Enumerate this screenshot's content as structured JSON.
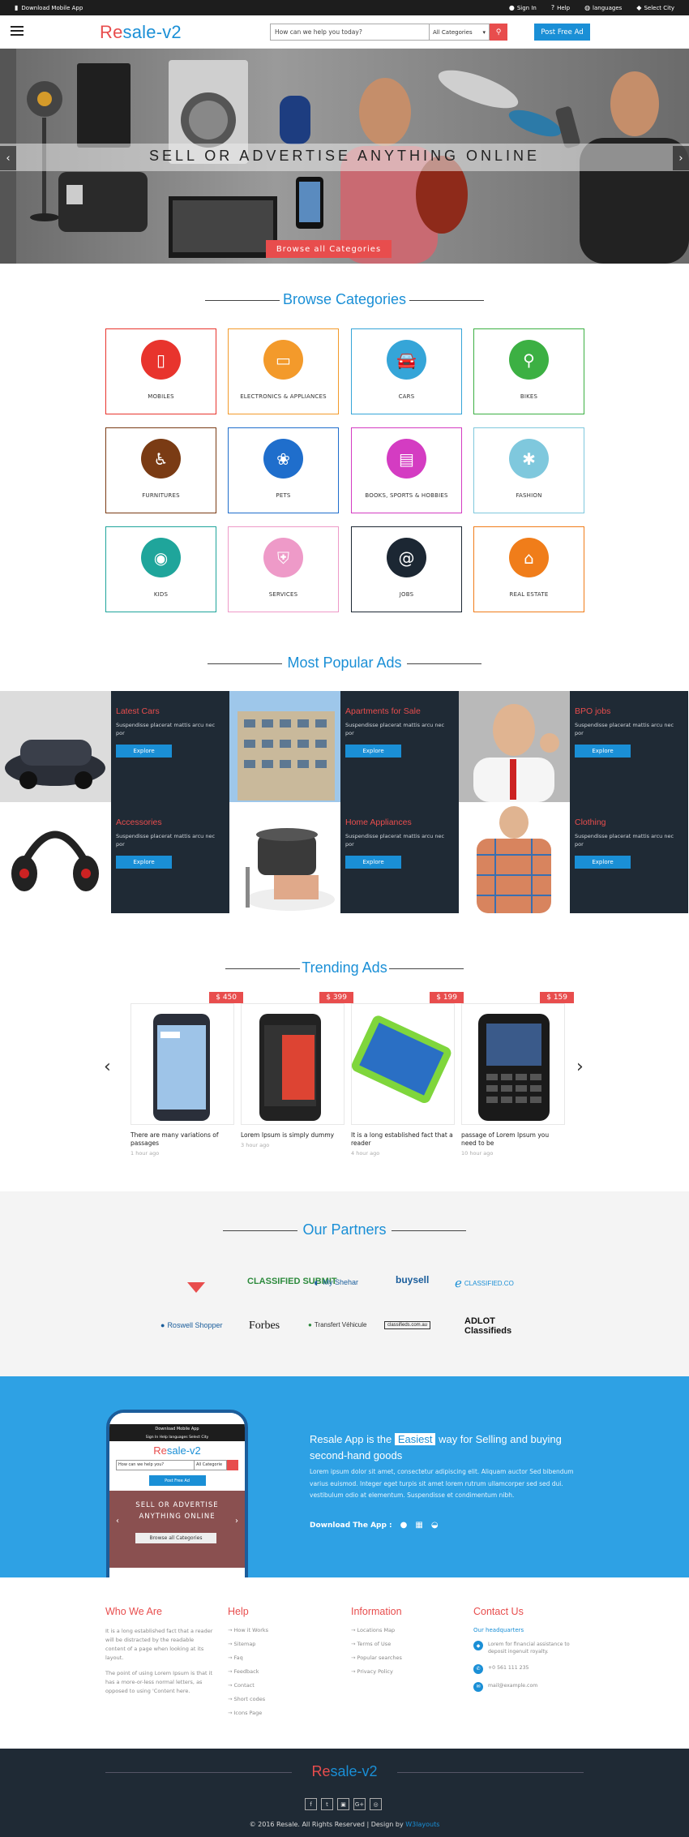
{
  "topbar": {
    "download": "Download Mobile App",
    "signin": "Sign In",
    "help": "Help",
    "languages": "languages",
    "city": "Select City"
  },
  "header": {
    "logo_a": "Re",
    "logo_b": "sale-v2",
    "search_placeholder": "How can we help you today?",
    "category_select": "All Categories",
    "post_ad": "Post Free Ad"
  },
  "hero": {
    "title": "SELL OR ADVERTISE ANYTHING ONLINE",
    "button": "Browse all Categories"
  },
  "categories": {
    "title": "Browse Categories",
    "items": [
      {
        "label": "MOBILES",
        "color": "#e8342d",
        "icon": "mobile-icon",
        "glyph": "▯"
      },
      {
        "label": "ELECTRONICS & APPLIANCES",
        "color": "#f39a2b",
        "icon": "laptop-icon",
        "glyph": "▭"
      },
      {
        "label": "CARS",
        "color": "#35a5d8",
        "icon": "car-icon",
        "glyph": "🚘"
      },
      {
        "label": "BIKES",
        "color": "#3cb043",
        "icon": "bike-icon",
        "glyph": "⚲"
      },
      {
        "label": "FURNITURES",
        "color": "#7a3b14",
        "icon": "wheelchair-icon",
        "glyph": "♿"
      },
      {
        "label": "PETS",
        "color": "#1f6ecc",
        "icon": "paw-icon",
        "glyph": "❀"
      },
      {
        "label": "BOOKS, SPORTS & HOBBIES",
        "color": "#d43cc2",
        "icon": "book-icon",
        "glyph": "▤"
      },
      {
        "label": "FASHION",
        "color": "#7fc8dd",
        "icon": "asterisk-icon",
        "glyph": "✱"
      },
      {
        "label": "KIDS",
        "color": "#1fa59b",
        "icon": "gamepad-icon",
        "glyph": "◉"
      },
      {
        "label": "SERVICES",
        "color": "#ee9ac8",
        "icon": "shield-icon",
        "glyph": "⛨"
      },
      {
        "label": "JOBS",
        "color": "#1c2733",
        "icon": "at-icon",
        "glyph": "@"
      },
      {
        "label": "REAL ESTATE",
        "color": "#f07d1a",
        "icon": "home-icon",
        "glyph": "⌂"
      }
    ]
  },
  "popular": {
    "title": "Most Popular Ads",
    "items": [
      {
        "title": "Latest Cars",
        "desc": "Suspendisse placerat mattis arcu nec por",
        "btn": "Explore"
      },
      {
        "title": "Apartments for Sale",
        "desc": "Suspendisse placerat mattis arcu nec por",
        "btn": "Explore"
      },
      {
        "title": "BPO jobs",
        "desc": "Suspendisse placerat mattis arcu nec por",
        "btn": "Explore"
      },
      {
        "title": "Accessories",
        "desc": "Suspendisse placerat mattis arcu nec por",
        "btn": "Explore"
      },
      {
        "title": "Home Appliances",
        "desc": "Suspendisse placerat mattis arcu nec por",
        "btn": "Explore"
      },
      {
        "title": "Clothing",
        "desc": "Suspendisse placerat mattis arcu nec por",
        "btn": "Explore"
      }
    ]
  },
  "trending": {
    "title": "Trending Ads",
    "items": [
      {
        "price": "$ 450",
        "title": "There are many variations of passages",
        "time": "1 hour ago"
      },
      {
        "price": "$ 399",
        "title": "Lorem Ipsum is simply dummy",
        "time": "3 hour ago"
      },
      {
        "price": "$ 199",
        "title": "It is a long established fact that a reader",
        "time": "4 hour ago"
      },
      {
        "price": "$ 159",
        "title": "passage of Lorem Ipsum you need to be",
        "time": "10 hour ago"
      }
    ]
  },
  "partners": {
    "title": "Our Partners",
    "logos": [
      "CLASSIFIED SUBMIT",
      "My Shehar",
      "buysell",
      "CLASSIFIED.CO",
      "Roswell Shopper",
      "Forbes",
      "Transfert Véhicule",
      "classifieds.com.au",
      "ADLOT Classifieds"
    ]
  },
  "app": {
    "heading_a": "Resale App is the",
    "heading_hl": "Easiest",
    "heading_b": "way for Selling and buying second-hand goods",
    "desc": "Lorem ipsum dolor sit amet, consectetur adipiscing elit. Aliquam auctor Sed bibendum varius euismod. Integer eget turpis sit amet lorem rutrum ullamcorper sed sed dui. vestibulum odio at elementum. Suspendisse et condimentum nibh.",
    "download": "Download The App :",
    "phone_top": "Download Mobile App",
    "phone_links": "Sign In   Help   languages   Select City",
    "phone_search": "How can we help you?",
    "phone_select": "All Categorie",
    "phone_post": "Post Free Ad",
    "phone_hero": "SELL OR ADVERTISE ANYTHING ONLINE",
    "phone_btn": "Browse all Categories"
  },
  "footer": {
    "who_title": "Who We Are",
    "who_p1": "It is a long established fact that a reader will be distracted by the readable content of a page when looking at its layout.",
    "who_p2": "The point of using Lorem Ipsum is that it has a more-or-less normal letters, as opposed to using 'Content here.",
    "help_title": "Help",
    "help_links": [
      "How it Works",
      "Sitemap",
      "Faq",
      "Feedback",
      "Contact",
      "Short codes",
      "Icons Page"
    ],
    "info_title": "Information",
    "info_links": [
      "Locations Map",
      "Terms of Use",
      "Popular searches",
      "Privacy Policy"
    ],
    "contact_title": "Contact Us",
    "hq": "Our headquarters",
    "addr": "Lorem for financial assistance to deposit ingenuit royalty.",
    "phone": "+0 561 111 235",
    "email": "mail@example.com",
    "logo_a": "Re",
    "logo_b": "sale-v2",
    "copy": "© 2016 Resale. All Rights Reserved | Design by",
    "w3": "W3layouts"
  }
}
